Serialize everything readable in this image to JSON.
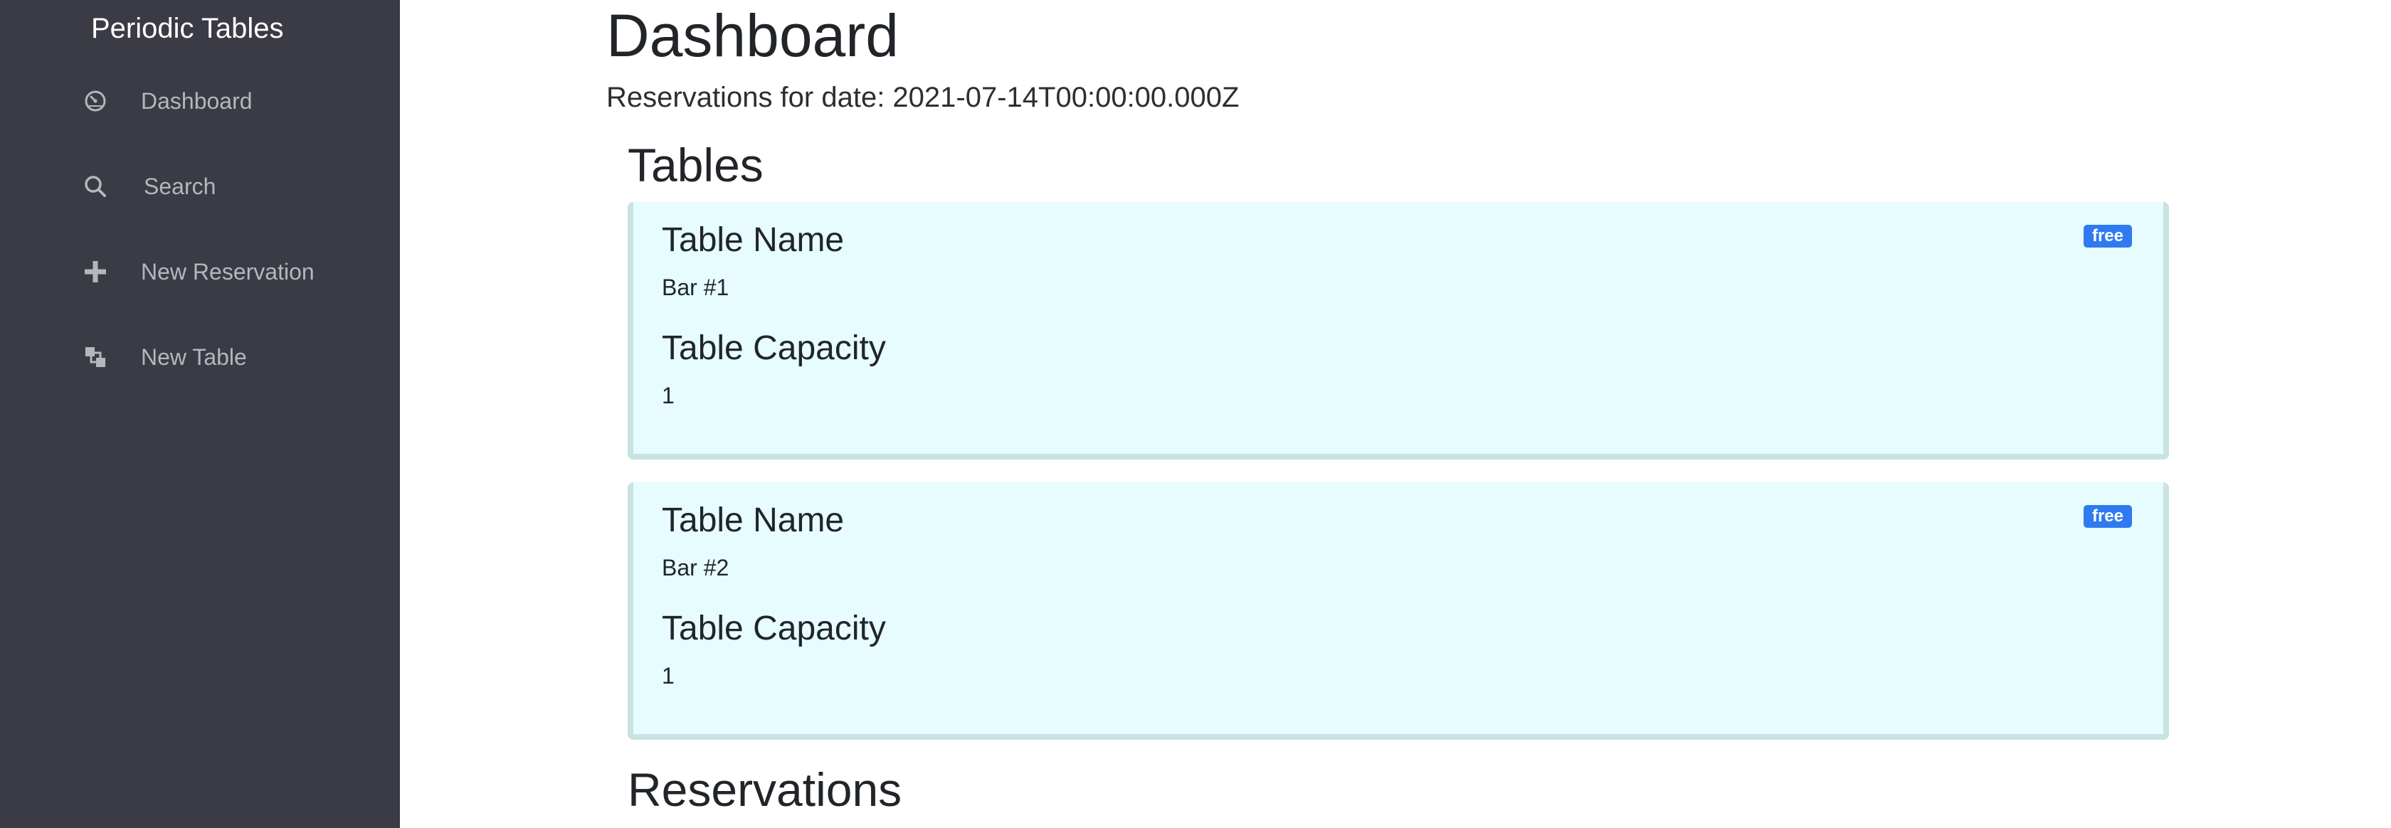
{
  "sidebar": {
    "brand": "Periodic Tables",
    "items": [
      {
        "label": "Dashboard",
        "icon": "dashboard-icon"
      },
      {
        "label": "Search",
        "icon": "search-icon"
      },
      {
        "label": "New Reservation",
        "icon": "plus-icon"
      },
      {
        "label": "New Table",
        "icon": "new-table-icon"
      }
    ]
  },
  "main": {
    "title": "Dashboard",
    "date_line": "Reservations for date: 2021-07-14T00:00:00.000Z",
    "tables_heading": "Tables",
    "tables": [
      {
        "name_label": "Table Name",
        "name": "Bar #1",
        "capacity_label": "Table Capacity",
        "capacity": "1",
        "status": "free"
      },
      {
        "name_label": "Table Name",
        "name": "Bar #2",
        "capacity_label": "Table Capacity",
        "capacity": "1",
        "status": "free"
      }
    ],
    "reservations_heading": "Reservations"
  },
  "colors": {
    "sidebar_bg": "#3a3b44",
    "card_bg": "#e6fcfe",
    "badge": "#2f7af0"
  }
}
